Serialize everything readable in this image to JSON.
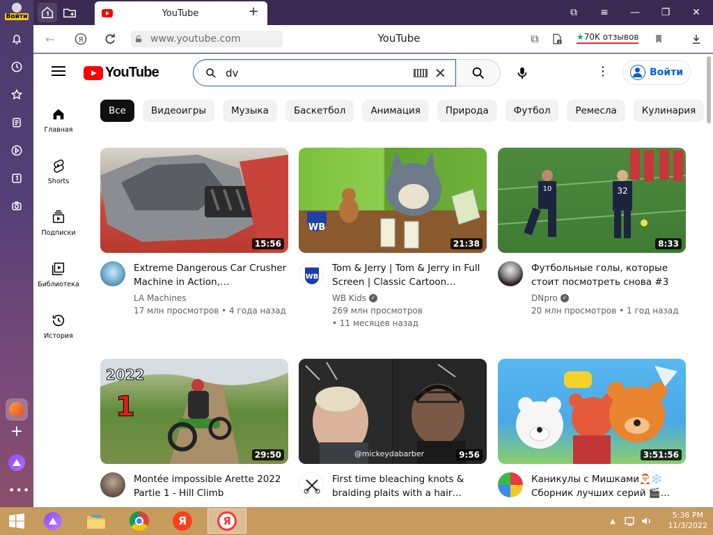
{
  "yandex_sidebar": {
    "login_label": "Войти"
  },
  "tabs": {
    "active_title": "YouTube"
  },
  "addressbar": {
    "url": "www.youtube.com",
    "page_title": "YouTube",
    "reviews": "70K отзывов",
    "ext_badge": "1"
  },
  "youtube": {
    "logo_text": "YouTube",
    "search_value": "dv",
    "signin_label": "Войти",
    "nav": [
      {
        "label": "Главная",
        "icon": "home-icon"
      },
      {
        "label": "Shorts",
        "icon": "shorts-icon"
      },
      {
        "label": "Подписки",
        "icon": "subscriptions-icon"
      },
      {
        "label": "Библиотека",
        "icon": "library-icon"
      },
      {
        "label": "История",
        "icon": "history-icon"
      }
    ],
    "chips": [
      "Все",
      "Видеоигры",
      "Музыка",
      "Баскетбол",
      "Анимация",
      "Природа",
      "Футбол",
      "Ремесла",
      "Кулинария"
    ],
    "videos": [
      {
        "title": "Extreme Dangerous Car Crusher Machine in Action,…",
        "channel": "LA Machines",
        "verified": false,
        "stats1": "17 млн просмотров • 4 года назад",
        "stats2": "",
        "duration": "15:56"
      },
      {
        "title": "Tom & Jerry | Tom & Jerry in Full Screen | Classic Cartoon…",
        "channel": "WB Kids",
        "verified": true,
        "stats1": "269 млн просмотров",
        "stats2": "• 11 месяцев назад",
        "duration": "21:38"
      },
      {
        "title": "Футбольные голы, которые стоит посмотреть снова #3",
        "channel": "DNpro",
        "verified": true,
        "stats1": "20 млн просмотров • 1 год назад",
        "stats2": "",
        "duration": "8:33"
      },
      {
        "title": "Montée impossible Arette 2022 Partie 1 - Hill Climb",
        "channel": "",
        "verified": false,
        "stats1": "",
        "stats2": "",
        "duration": "29:50"
      },
      {
        "title": "First time bleaching knots & braiding plaits with a hair…",
        "channel": "",
        "verified": false,
        "stats1": "",
        "stats2": "",
        "duration": "9:56"
      },
      {
        "title": "Каникулы с Мишками🎅❄️ Сборник лучших серий 🎬…",
        "channel": "",
        "verified": false,
        "stats1": "",
        "stats2": "",
        "duration": "3:51:56"
      }
    ],
    "thumb_text": {
      "year": "2022",
      "rank": "1",
      "jersey_a": "10",
      "jersey_b": "32",
      "watermark": "@mickeydabarber",
      "wb": "WB"
    }
  },
  "taskbar": {
    "time": "5:36 PM",
    "date": "11/3/2022",
    "yandex_letter": "Я"
  }
}
